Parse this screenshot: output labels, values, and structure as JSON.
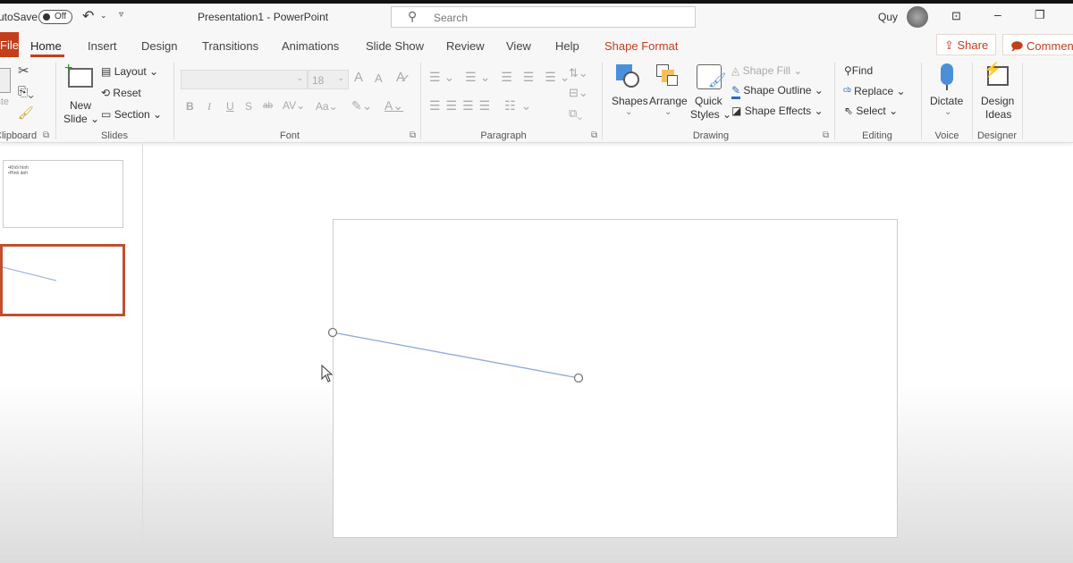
{
  "titlebar": {
    "autosave_label": "AutoSave",
    "autosave_state": "Off",
    "title": "Presentation1  -  PowerPoint",
    "search_placeholder": "Search",
    "user": "Quy"
  },
  "tabs": {
    "file": "File",
    "items": [
      "Home",
      "Insert",
      "Design",
      "Transitions",
      "Animations",
      "Slide Show",
      "Review",
      "View",
      "Help",
      "Shape Format"
    ],
    "active": "Home",
    "share": "Share",
    "comments": "Comments"
  },
  "ribbon": {
    "clipboard": {
      "paste": "Paste",
      "group": "Clipboard"
    },
    "slides": {
      "new_slide_1": "New",
      "new_slide_2": "Slide",
      "layout": "Layout",
      "reset": "Reset",
      "section": "Section",
      "group": "Slides"
    },
    "font": {
      "font_size": "18",
      "bold": "B",
      "italic": "I",
      "underline": "U",
      "shadow": "S",
      "strike": "ab",
      "spacing": "AV",
      "case": "Aa",
      "color": "A",
      "grow": "A",
      "shrink": "A",
      "group": "Font"
    },
    "paragraph": {
      "group": "Paragraph"
    },
    "drawing": {
      "shapes": "Shapes",
      "arrange": "Arrange",
      "quick_1": "Quick",
      "quick_2": "Styles",
      "fill": "Shape Fill",
      "outline": "Shape Outline",
      "effects": "Shape Effects",
      "group": "Drawing"
    },
    "editing": {
      "find": "Find",
      "replace": "Replace",
      "select": "Select",
      "group": "Editing"
    },
    "voice": {
      "dictate": "Dictate",
      "group": "Voice"
    },
    "designer": {
      "ideas_1": "Design",
      "ideas_2": "Ideas",
      "group": "Designer"
    }
  },
  "thumbnails": [
    {
      "lines": [
        "•Khối hình",
        "•Hình ảnh"
      ]
    },
    {
      "lines": []
    }
  ],
  "colors": {
    "accent": "#c43e1c",
    "line": "#8faadc"
  }
}
